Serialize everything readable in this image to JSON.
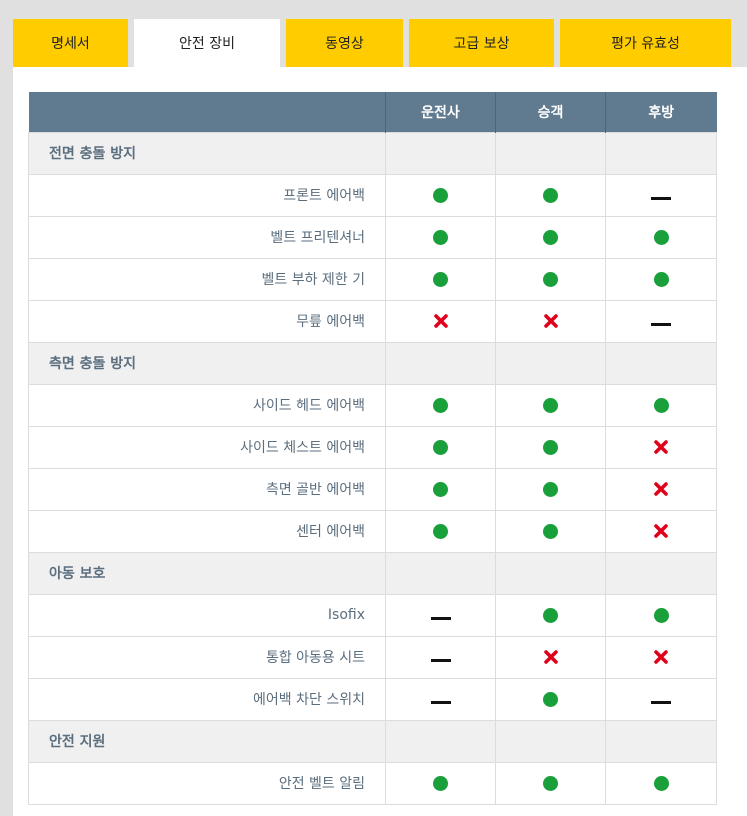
{
  "tabs": [
    {
      "label": "명세서",
      "active": false
    },
    {
      "label": "안전 장비",
      "active": true
    },
    {
      "label": "동영상",
      "active": false
    },
    {
      "label": "고급 보상",
      "active": false
    },
    {
      "label": "평가 유효성",
      "active": false
    }
  ],
  "table": {
    "headers": [
      "",
      "운전사",
      "승객",
      "후방"
    ],
    "sections": [
      {
        "title": "전면 충돌 방지",
        "rows": [
          {
            "label": "프론트 에어백",
            "values": [
              "yes",
              "yes",
              "none"
            ]
          },
          {
            "label": "벨트 프리텐셔너",
            "values": [
              "yes",
              "yes",
              "yes"
            ]
          },
          {
            "label": "벨트 부하 제한 기",
            "values": [
              "yes",
              "yes",
              "yes"
            ]
          },
          {
            "label": "무릎 에어백",
            "values": [
              "no",
              "no",
              "none"
            ]
          }
        ]
      },
      {
        "title": "측면 충돌 방지",
        "rows": [
          {
            "label": "사이드 헤드 에어백",
            "values": [
              "yes",
              "yes",
              "yes"
            ]
          },
          {
            "label": "사이드 체스트 에어백",
            "values": [
              "yes",
              "yes",
              "no"
            ]
          },
          {
            "label": "측면 골반 에어백",
            "values": [
              "yes",
              "yes",
              "no"
            ]
          },
          {
            "label": "센터 에어백",
            "values": [
              "yes",
              "yes",
              "no"
            ]
          }
        ]
      },
      {
        "title": "아동 보호",
        "rows": [
          {
            "label": "Isofix",
            "values": [
              "none",
              "yes",
              "yes"
            ]
          },
          {
            "label": "통합 아동용 시트",
            "values": [
              "none",
              "no",
              "no"
            ]
          },
          {
            "label": "에어백 차단 스위치",
            "values": [
              "none",
              "yes",
              "none"
            ]
          }
        ]
      },
      {
        "title": "안전 지원",
        "rows": [
          {
            "label": "안전 벨트 알림",
            "values": [
              "yes",
              "yes",
              "yes"
            ]
          }
        ]
      }
    ]
  },
  "icons": {
    "yes": "green-dot-icon",
    "no": "red-cross-icon",
    "none": "dash-icon"
  },
  "colors": {
    "tab": "#ffcc00",
    "header": "#607b8f",
    "yes": "#1aa03a",
    "no": "#e0001a",
    "label": "#5b6e7e"
  }
}
